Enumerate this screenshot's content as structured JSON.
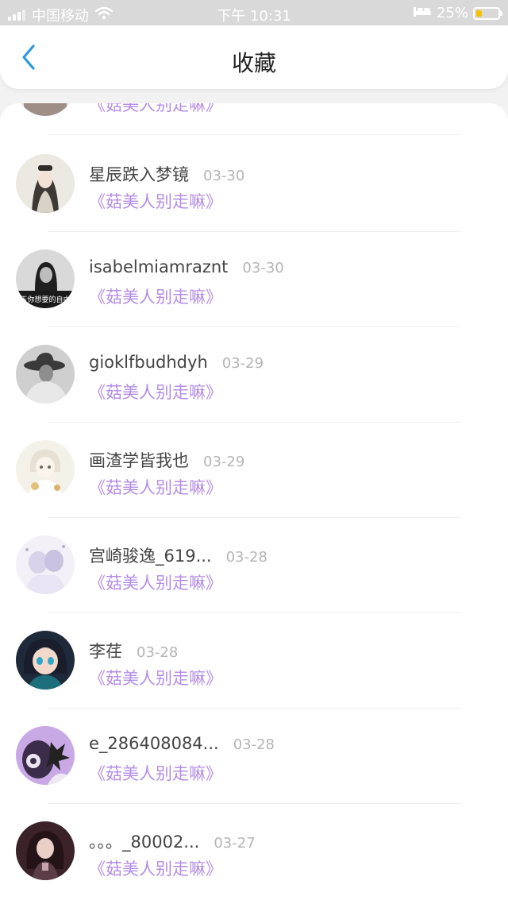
{
  "status_bar": {
    "carrier": "中国移动",
    "time": "下午 10:31",
    "battery_percent": "25%",
    "battery_level": 0.25
  },
  "navbar": {
    "title": "收藏"
  },
  "favorites": [
    {
      "name": "",
      "date": "",
      "book": "《菇美人别走嘛》"
    },
    {
      "name": "星辰跌入梦镜",
      "date": "03-30",
      "book": "《菇美人别走嘛》"
    },
    {
      "name": "isabelmiamraznt",
      "date": "03-30",
      "book": "《菇美人别走嘛》"
    },
    {
      "name": "gioklfbudhdyh",
      "date": "03-29",
      "book": "《菇美人别走嘛》"
    },
    {
      "name": "画渣学皆我也",
      "date": "03-29",
      "book": "《菇美人别走嘛》"
    },
    {
      "name": "宫崎骏逸_619...",
      "date": "03-28",
      "book": "《菇美人别走嘛》"
    },
    {
      "name": "李荏",
      "date": "03-28",
      "book": "《菇美人别走嘛》"
    },
    {
      "name": "e_286408084...",
      "date": "03-28",
      "book": "《菇美人别走嘛》"
    },
    {
      "name": "。。。_80002...",
      "date": "03-27",
      "book": "《菇美人别走嘛》"
    }
  ],
  "avatar_text": "玉你想要的自由",
  "colors": {
    "book_link": "#b48de6",
    "date_text": "#b5b5b5",
    "name_text": "#444444",
    "back_icon": "#2a9ae0",
    "status_bar_bg": "#d9d9d9",
    "battery_fill": "#f4c400"
  }
}
